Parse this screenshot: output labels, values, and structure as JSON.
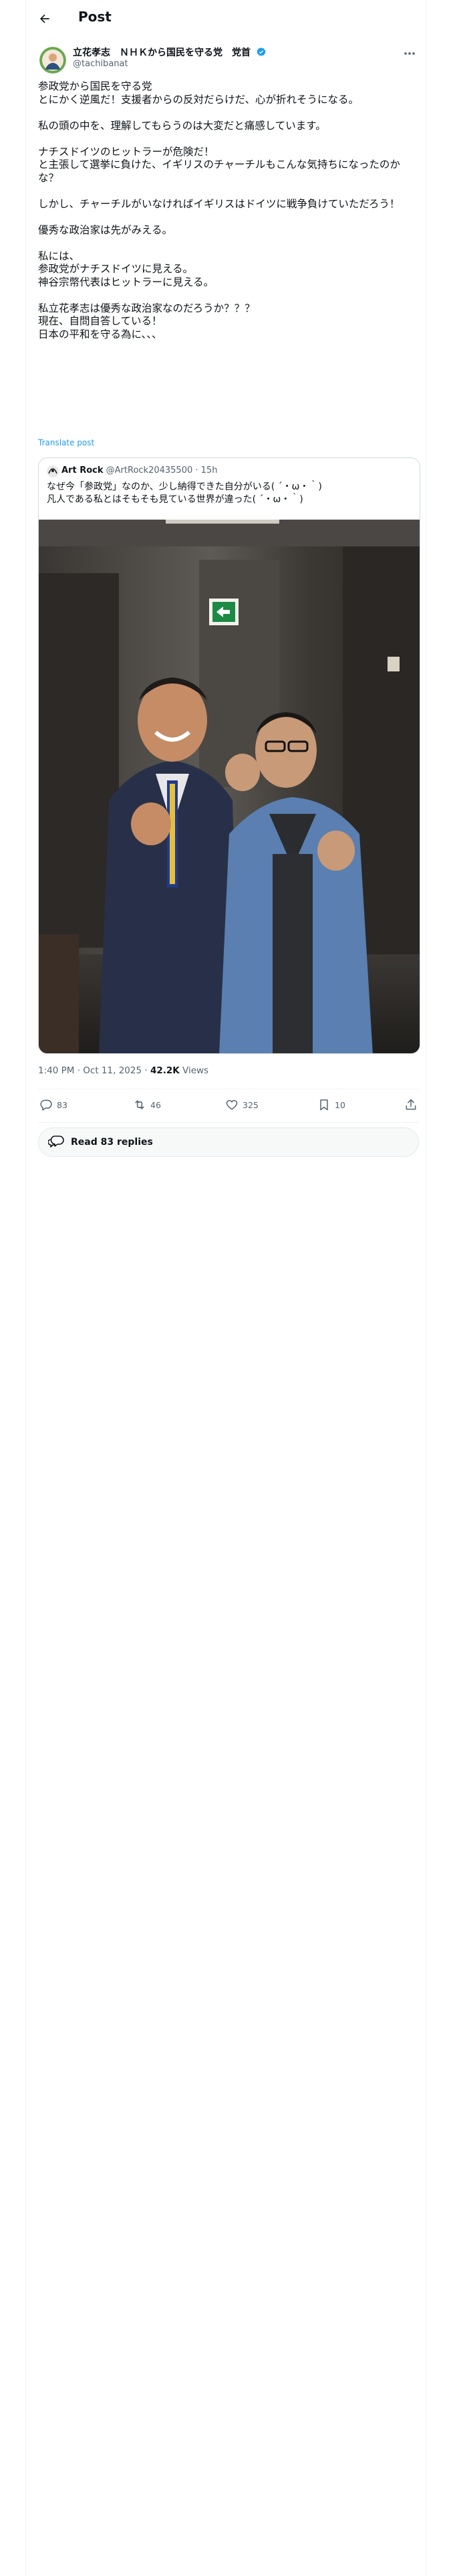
{
  "header": {
    "title": "Post",
    "back_icon": "arrow-left-icon"
  },
  "author": {
    "name": "立花孝志　ＮＨＫから国民を守る党　党首",
    "handle": "@tachibanat",
    "verified": true,
    "accent": "#1d9bf0"
  },
  "post": {
    "paragraphs": [
      [
        "参政党から国民を守る党",
        "とにかく逆風だ！支援者からの反対だらけだ、心が折れそうになる。"
      ],
      [
        "私の頭の中を、理解してもらうのは大変だと痛感しています。"
      ],
      [
        "ナチスドイツのヒットラーが危険だ！",
        "と主張して選挙に負けた、イギリスのチャーチルもこんな気持ちになったのかな？"
      ],
      [
        "しかし、チャーチルがいなければイギリスはドイツに戦争負けていただろう！"
      ],
      [
        "優秀な政治家は先がみえる。"
      ],
      [
        "私には、",
        "参政党がナチスドイツに見える。",
        "神谷宗幣代表はヒットラーに見える。"
      ],
      [
        "私立花孝志は優秀な政治家なのだろうか？？？",
        "現在、自問自答している！",
        "日本の平和を守る為に、、、"
      ]
    ],
    "translate_label": "Translate post"
  },
  "quote": {
    "name": "Art Rock",
    "handle": "@ArtRock20435500",
    "time": "15h",
    "text": [
      "なぜ今「参政党」なのか、少し納得できた自分がいる( ´・ω・｀)",
      "凡人である私とはそもそも見ている世界が違った( ´・ω・｀)"
    ]
  },
  "meta": {
    "time": "1:40 PM",
    "date": "Oct 11, 2025",
    "views_count": "42.2K",
    "views_label": "Views"
  },
  "actions": {
    "replies": "83",
    "reposts": "46",
    "likes": "325",
    "bookmarks": "10"
  },
  "read_replies_label": "Read 83 replies"
}
